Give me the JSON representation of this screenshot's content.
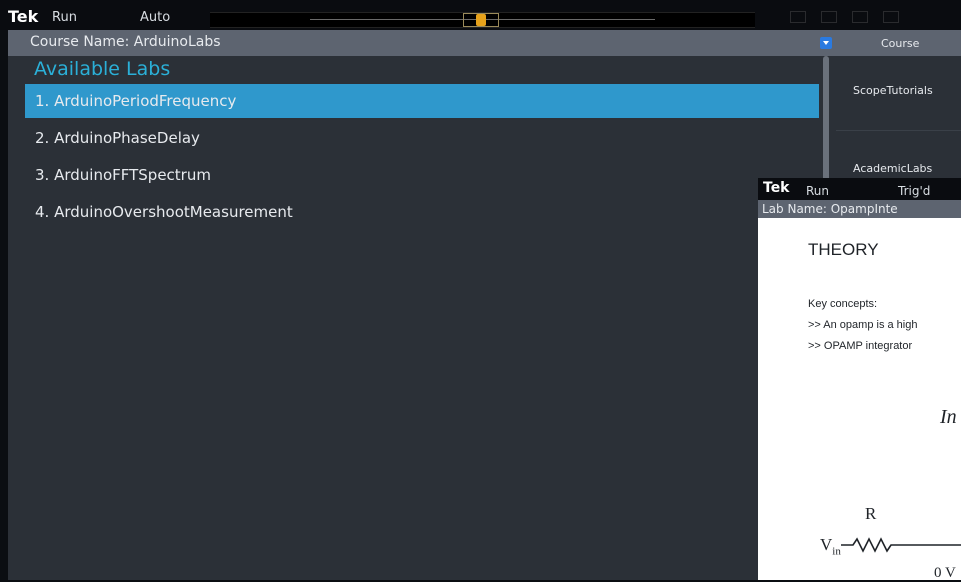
{
  "topbar": {
    "logo": "Tek",
    "run_state": "Run",
    "trigger_mode": "Auto"
  },
  "course": {
    "title": "Course Name: ArduinoLabs",
    "available_label": "Available Labs",
    "labs": [
      "1. ArduinoPeriodFrequency",
      "2. ArduinoPhaseDelay",
      "3. ArduinoFFTSpectrum",
      "4. ArduinoOvershootMeasurement"
    ],
    "selected_index": 0
  },
  "course_panel": {
    "header": "Course",
    "items": [
      "ScopeTutorials",
      "AcademicLabs"
    ]
  },
  "subwindow": {
    "logo": "Tek",
    "run_state": "Run",
    "trigger_state": "Trig'd",
    "lab_name": "Lab Name: OpampInte",
    "theory_heading": "THEORY",
    "key_concepts": "Key concepts:",
    "bullet_1": ">> An opamp is a high",
    "bullet_2": ">> OPAMP integrator",
    "diagram_title": "In",
    "diagram_r": "R",
    "diagram_vin": "V",
    "diagram_vin_sub": "in",
    "diagram_ov": "0 V"
  },
  "colors": {
    "accent": "#2f98cc",
    "heading": "#2bb0d8",
    "panel": "#2b3037",
    "header": "#5d6470"
  }
}
